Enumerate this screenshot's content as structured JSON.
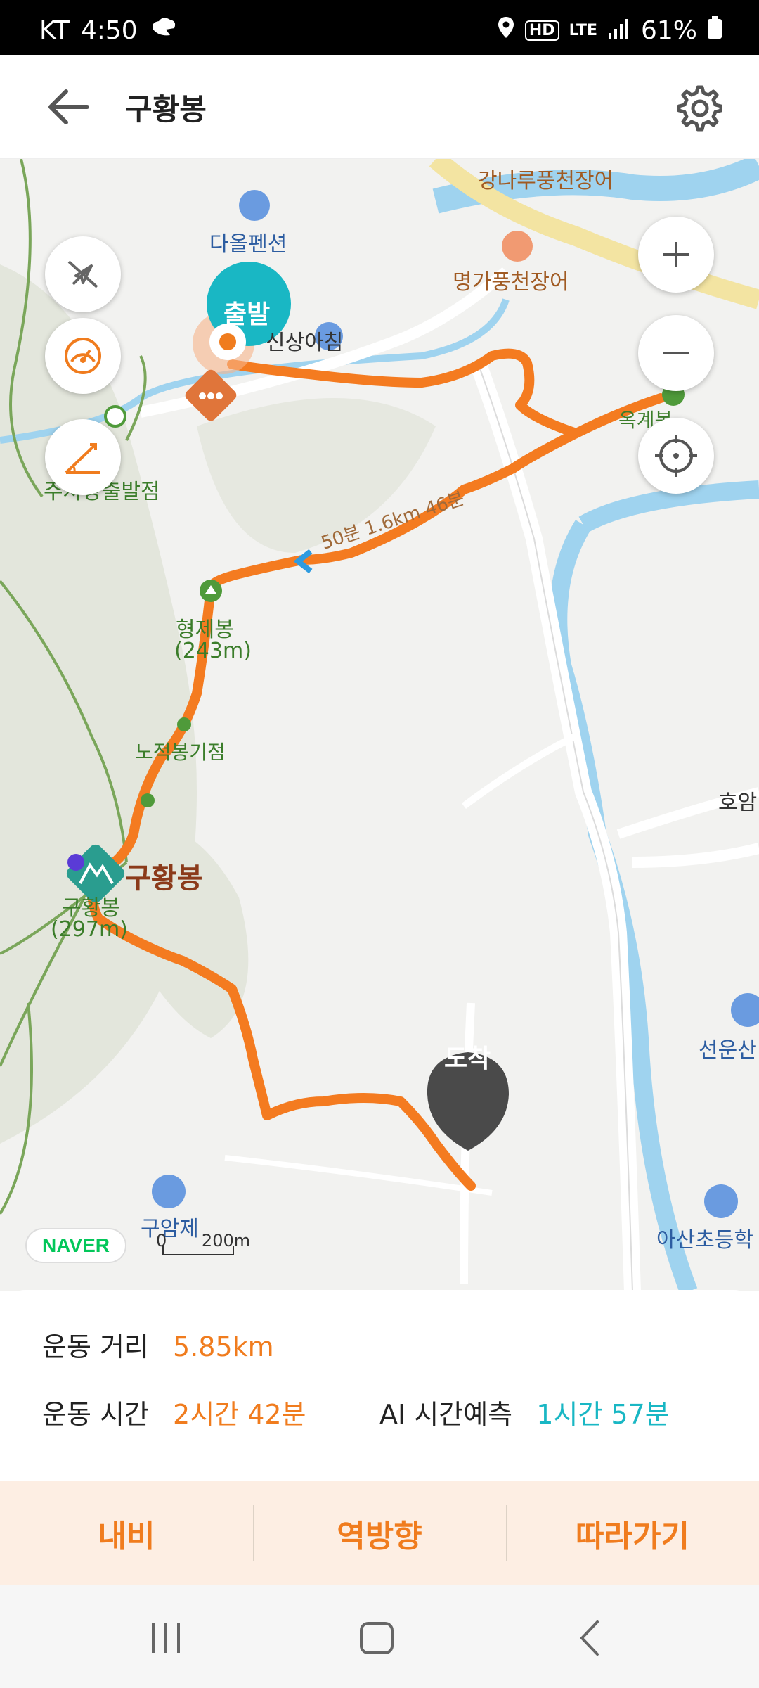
{
  "status_bar": {
    "carrier": "KT",
    "time": "4:50",
    "hd_label": "HD",
    "network": "LTE",
    "battery": "61%"
  },
  "app_bar": {
    "title": "구황봉"
  },
  "map": {
    "labels": {
      "kangnaru": "강나루풍천장어",
      "daol": "다올펜션",
      "myeongga": "명가풍천장어",
      "start_fragment": "주차장출발점",
      "hyeonggibong": "형제봉",
      "hyeonggibong_elev": "(243m)",
      "nojeok": "노적봉기점",
      "guhwangbong_big": "구황봉",
      "guhwangbong_small": "구황봉",
      "guhwangbong_elev": "(297m)",
      "guam": "구암제",
      "hoam": "호암",
      "seonun": "선운산",
      "asan": "아산초등학",
      "sinsang": "신상아침",
      "segment_label": "50분 1.6km 46분",
      "peak_right": "옥계봉"
    },
    "start_marker": "출발",
    "end_marker": "도착",
    "naver_logo": "NAVER",
    "scale_zero": "0",
    "scale_label": "200m"
  },
  "info": {
    "distance_label": "운동 거리",
    "distance_value": "5.85km",
    "time_label": "운동 시간",
    "time_value": "2시간 42분",
    "ai_label": "AI 시간예측",
    "ai_value": "1시간 57분"
  },
  "actions": {
    "navi": "내비",
    "reverse": "역방향",
    "follow": "따라가기"
  },
  "colors": {
    "route": "#f47b20",
    "teal": "#19b7c4",
    "accent_orange": "#f07c1e"
  }
}
